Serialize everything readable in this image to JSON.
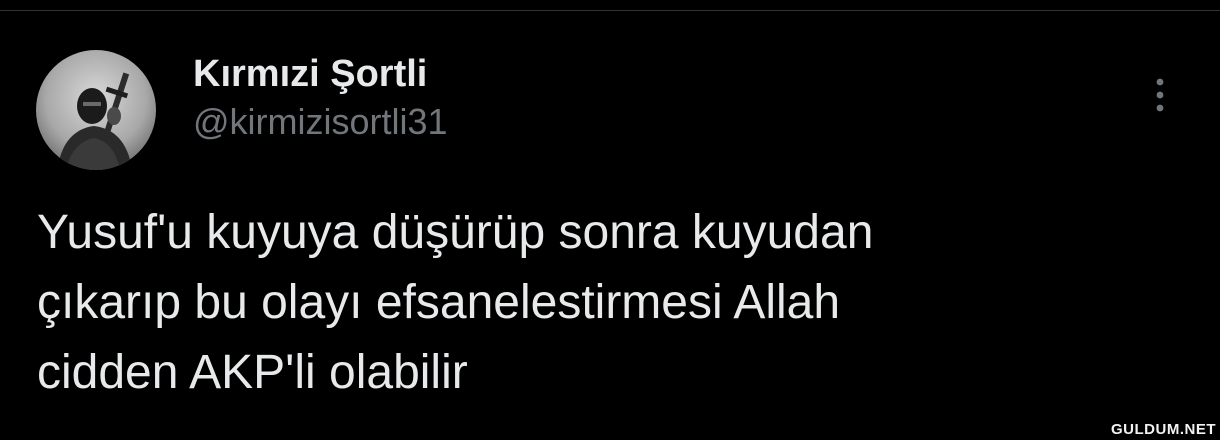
{
  "tweet": {
    "author": {
      "display_name": "Kırmızi Şortli",
      "handle": "@kirmizisortli31",
      "avatar_icon": "soldier-with-rifle-avatar"
    },
    "more_icon": "vertical-ellipsis-icon",
    "text": "Yusuf'u kuyuya düşürüp sonra kuyudan\nçıkarıp bu olayı efsanelestirmesi Allah\ncidden AKP'li olabilir"
  },
  "watermark": "GULDUM.NET",
  "colors": {
    "background": "#000000",
    "primary_text": "#e7e9ea",
    "secondary_text": "#71767b",
    "divider": "#2f3336"
  }
}
